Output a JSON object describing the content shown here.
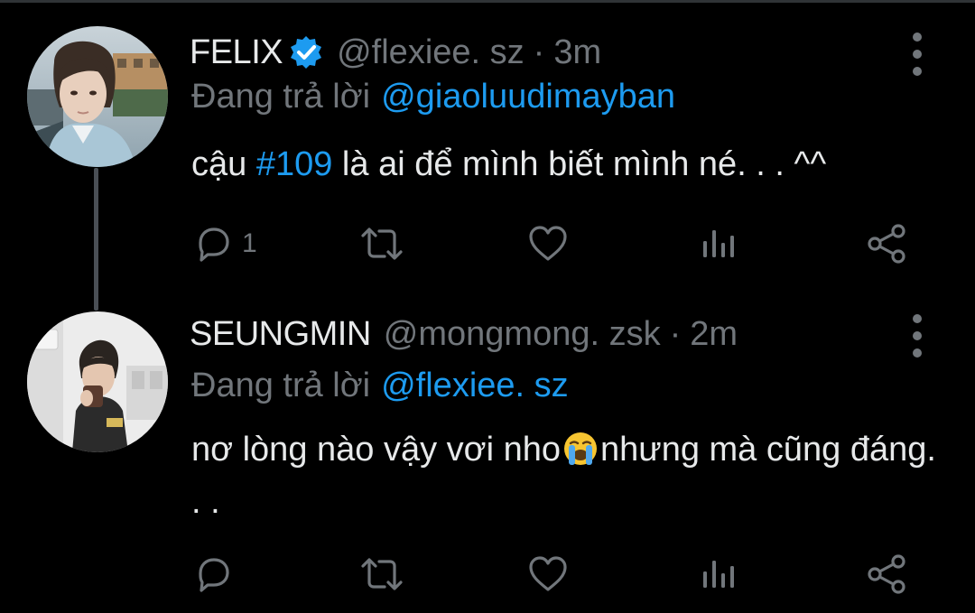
{
  "colors": {
    "background": "#000000",
    "text_primary": "#e7e9ea",
    "text_secondary": "#71767b",
    "accent": "#1d9bf0",
    "verified": "#1d9bf0",
    "thread_line": "#4a4f55"
  },
  "tweets": [
    {
      "display_name": "FELIX",
      "verified": true,
      "handle": "@flexiee. sz",
      "separator": "·",
      "time": "3m",
      "reply_prefix": "Đang trả lời",
      "reply_to": "@giaoluudimayban",
      "text_before": "cậu ",
      "hashtag": "#109",
      "text_after": " là ai để mình biết mình né. . . ^^",
      "actions": {
        "reply_count": "1",
        "retweet_count": "",
        "like_count": ""
      },
      "icons": [
        "avatar",
        "verified-badge-icon",
        "more-options-icon",
        "reply-icon",
        "retweet-icon",
        "like-icon",
        "analytics-icon",
        "share-icon"
      ]
    },
    {
      "display_name": "SEUNGMIN",
      "verified": false,
      "handle": "@mongmong. zsk",
      "separator": "·",
      "time": "2m",
      "reply_prefix": "Đang trả lời",
      "reply_to": "@flexiee. sz",
      "text_before": "nơ lòng nào vậy vơi nho",
      "emoji": "loudly-crying-face",
      "text_after": "nhưng mà cũng đáng. . .",
      "actions": {
        "reply_count": "",
        "retweet_count": "",
        "like_count": ""
      },
      "icons": [
        "avatar",
        "more-options-icon",
        "reply-icon",
        "retweet-icon",
        "like-icon",
        "analytics-icon",
        "share-icon"
      ]
    }
  ]
}
